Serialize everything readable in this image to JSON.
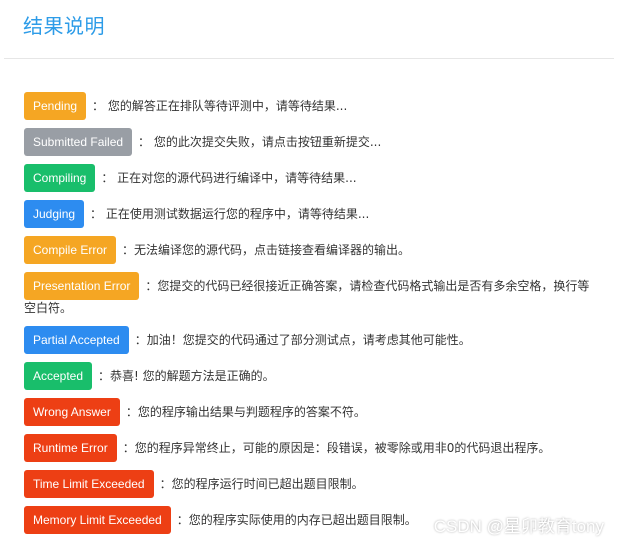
{
  "page": {
    "title": "结果说明"
  },
  "results": [
    {
      "label": "Pending",
      "color": "#f5a623",
      "desc": "：  您的解答正在排队等待评测中，请等待结果..."
    },
    {
      "label": "Submitted Failed",
      "color": "#999ea5",
      "desc": "：  您的此次提交失败，请点击按钮重新提交..."
    },
    {
      "label": "Compiling",
      "color": "#19be6b",
      "desc": "：  正在对您的源代码进行编译中，请等待结果..."
    },
    {
      "label": "Judging",
      "color": "#2d8cf0",
      "desc": "：  正在使用测试数据运行您的程序中，请等待结果..."
    },
    {
      "label": "Compile Error",
      "color": "#f5a623",
      "desc": "：无法编译您的源代码，点击链接查看编译器的输出。"
    },
    {
      "label": "Presentation Error",
      "color": "#f5a623",
      "desc": "：您提交的代码已经很接近正确答案，请检查代码格式输出是否有多余空格，换行等",
      "desc_cont": "空白符。"
    },
    {
      "label": "Partial Accepted",
      "color": "#2d8cf0",
      "desc": "：加油！您提交的代码通过了部分测试点，请考虑其他可能性。"
    },
    {
      "label": "Accepted",
      "color": "#19be6b",
      "desc": "：恭喜! 您的解题方法是正确的。"
    },
    {
      "label": "Wrong Answer",
      "color": "#ed3f14",
      "desc": "：您的程序输出结果与判题程序的答案不符。"
    },
    {
      "label": "Runtime Error",
      "color": "#ed3f14",
      "desc": "：您的程序异常终止，可能的原因是：段错误，被零除或用非0的代码退出程序。"
    },
    {
      "label": "Time Limit Exceeded",
      "color": "#ed3f14",
      "desc": "：您的程序运行时间已超出题目限制。"
    },
    {
      "label": "Memory Limit Exceeded",
      "color": "#ed3f14",
      "desc": "：您的程序实际使用的内存已超出题目限制。"
    }
  ],
  "watermark": "CSDN @星卯教育tony"
}
